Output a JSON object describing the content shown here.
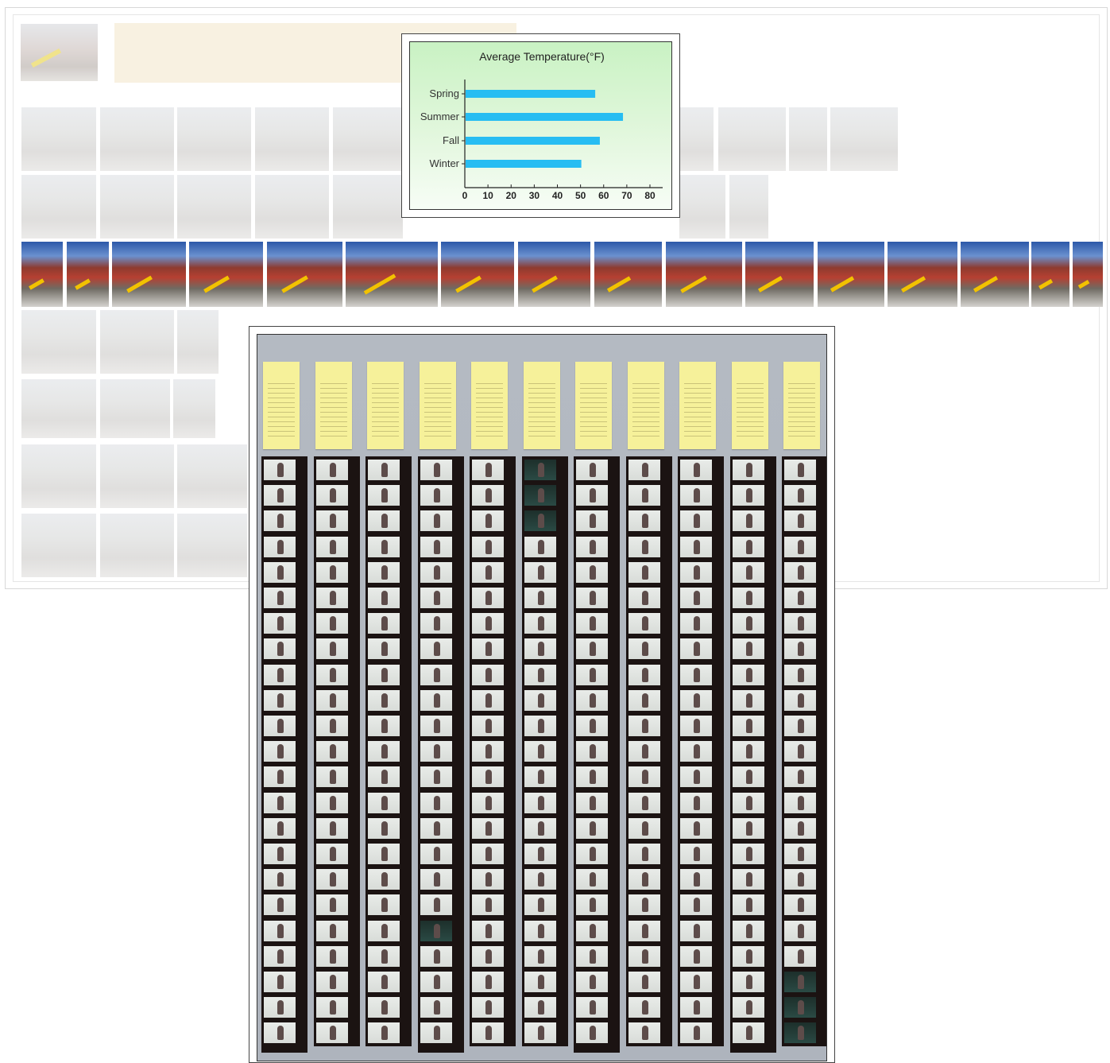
{
  "chart_data": {
    "type": "bar",
    "orientation": "horizontal",
    "title": "Average Temperature(°F)",
    "categories": [
      "Spring",
      "Summer",
      "Fall",
      "Winter"
    ],
    "values": [
      56,
      68,
      58,
      50
    ],
    "xlim": [
      0,
      80
    ],
    "xticks": [
      "0",
      "10",
      "20",
      "30",
      "40",
      "50",
      "60",
      "70",
      "80"
    ],
    "xlabel": "",
    "ylabel": "",
    "bar_color": "#27bdf2",
    "grid": false
  },
  "gallery": {
    "active_row_thumb_count": 15
  },
  "contact_sheet": {
    "strip_count": 11,
    "frames_per_strip": 23
  }
}
